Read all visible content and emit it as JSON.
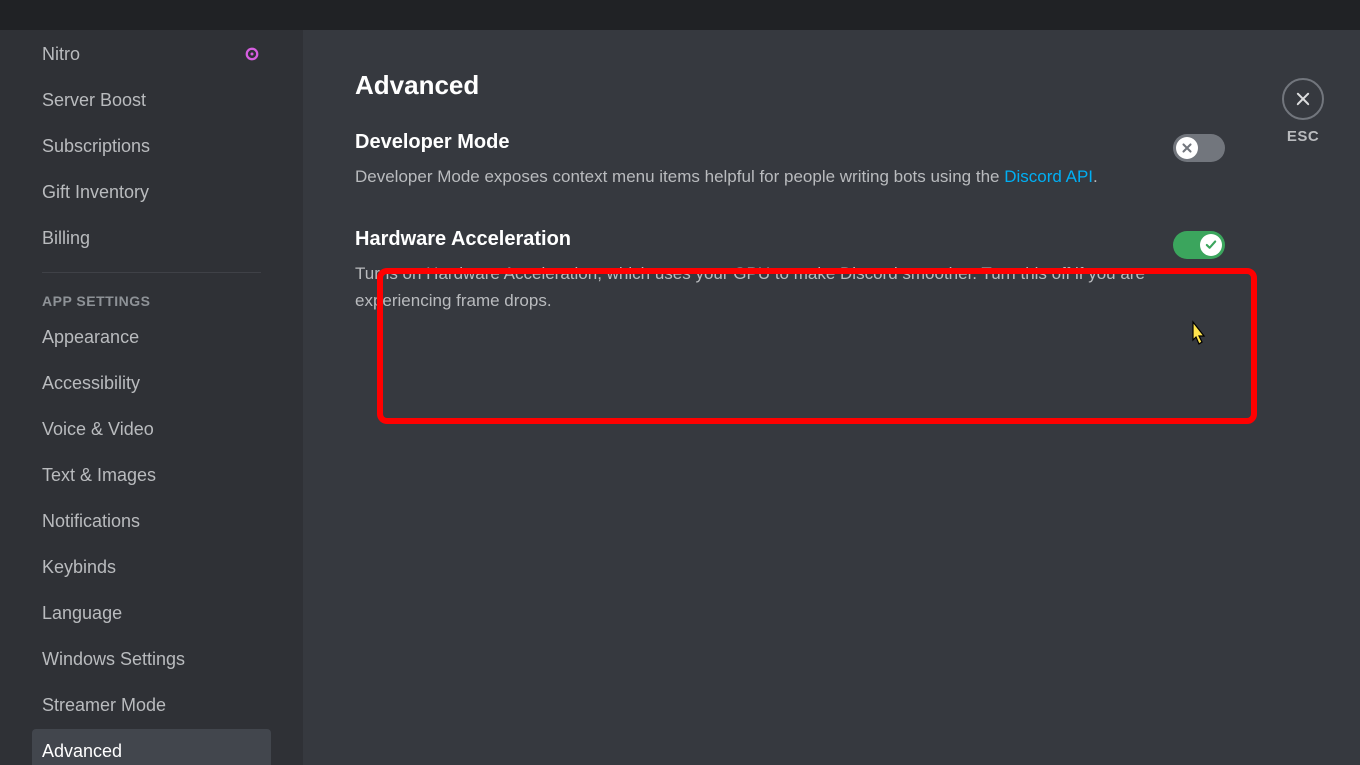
{
  "sidebar": {
    "billing_section": {
      "items": [
        {
          "label": "Nitro",
          "has_badge": true
        },
        {
          "label": "Server Boost",
          "has_badge": false
        },
        {
          "label": "Subscriptions",
          "has_badge": false
        },
        {
          "label": "Gift Inventory",
          "has_badge": false
        },
        {
          "label": "Billing",
          "has_badge": false
        }
      ]
    },
    "app_settings": {
      "header": "App Settings",
      "items": [
        {
          "label": "Appearance"
        },
        {
          "label": "Accessibility"
        },
        {
          "label": "Voice & Video"
        },
        {
          "label": "Text & Images"
        },
        {
          "label": "Notifications"
        },
        {
          "label": "Keybinds"
        },
        {
          "label": "Language"
        },
        {
          "label": "Windows Settings"
        },
        {
          "label": "Streamer Mode"
        },
        {
          "label": "Advanced",
          "selected": true
        }
      ]
    }
  },
  "main": {
    "title": "Advanced",
    "developer_mode": {
      "title": "Developer Mode",
      "description_pre": "Developer Mode exposes context menu items helpful for people writing bots using the ",
      "link_text": "Discord API",
      "description_post": ".",
      "enabled": false
    },
    "hardware_acceleration": {
      "title": "Hardware Acceleration",
      "description": "Turns on Hardware Acceleration, which uses your GPU to make Discord smoother. Turn this off if you are experiencing frame drops.",
      "enabled": true
    }
  },
  "close": {
    "label": "ESC"
  }
}
